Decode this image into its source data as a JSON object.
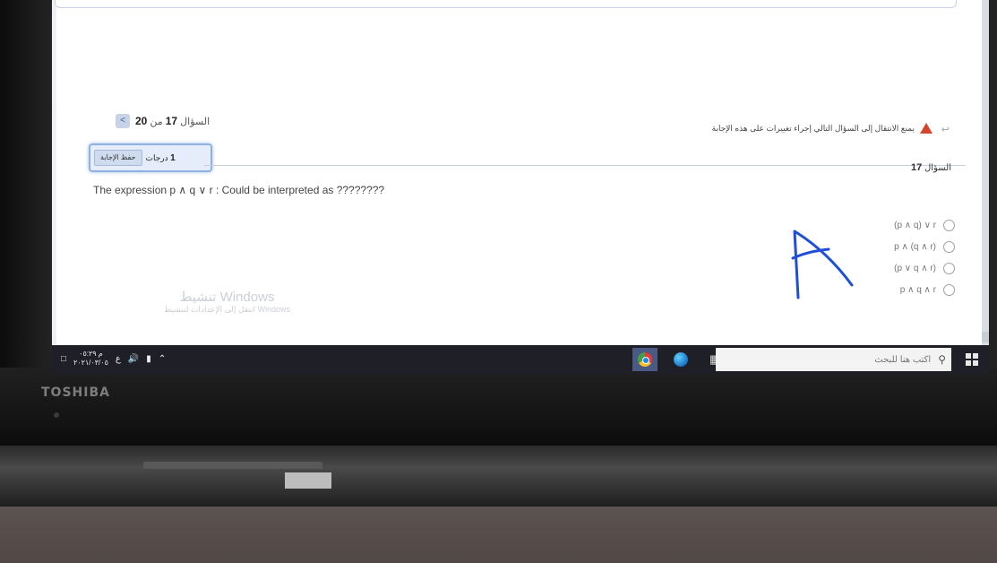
{
  "laptop": {
    "brand": "TOSHIBA"
  },
  "quiz": {
    "nav_prefix": "السؤال",
    "current": "17",
    "of": "من",
    "total": "20",
    "warning": "يمنع الانتقال إلى السؤال التالي إجراء تغييرات على هذه الإجابة",
    "save_button": "حفظ الإجابة",
    "grade_value": "1",
    "grade_unit": "درجات",
    "question_label": "السؤال",
    "question_number": "17",
    "question_text": "The expression p ∧ q ∨ r : Could be interpreted as ????????",
    "options": [
      {
        "text": "(p ∧ q) ∨ r"
      },
      {
        "text": "p ∧ (q ∧ r)"
      },
      {
        "text": "(p ∨ q ∧ r)"
      },
      {
        "text": "p ∧ q ∧ r"
      }
    ],
    "handwritten_mark": "A"
  },
  "activation": {
    "title": "تنشيط Windows",
    "subtitle": "انتقل إلى الإعدادات لتنشيط Windows"
  },
  "taskbar": {
    "search_placeholder": "اكتب هنا للبحث",
    "time": "م ٠٥:٢٩",
    "date": "٢٠٢١/٠٣/٠٥",
    "lang": "ع",
    "apps": [
      "chrome-icon",
      "edge-icon",
      "task-view-icon"
    ]
  },
  "colors": {
    "page": "#ffffff",
    "accent": "#8fb1e3",
    "warning": "#d3452c",
    "ink": "#1f4fd6",
    "taskbar": "#1f1f28"
  }
}
